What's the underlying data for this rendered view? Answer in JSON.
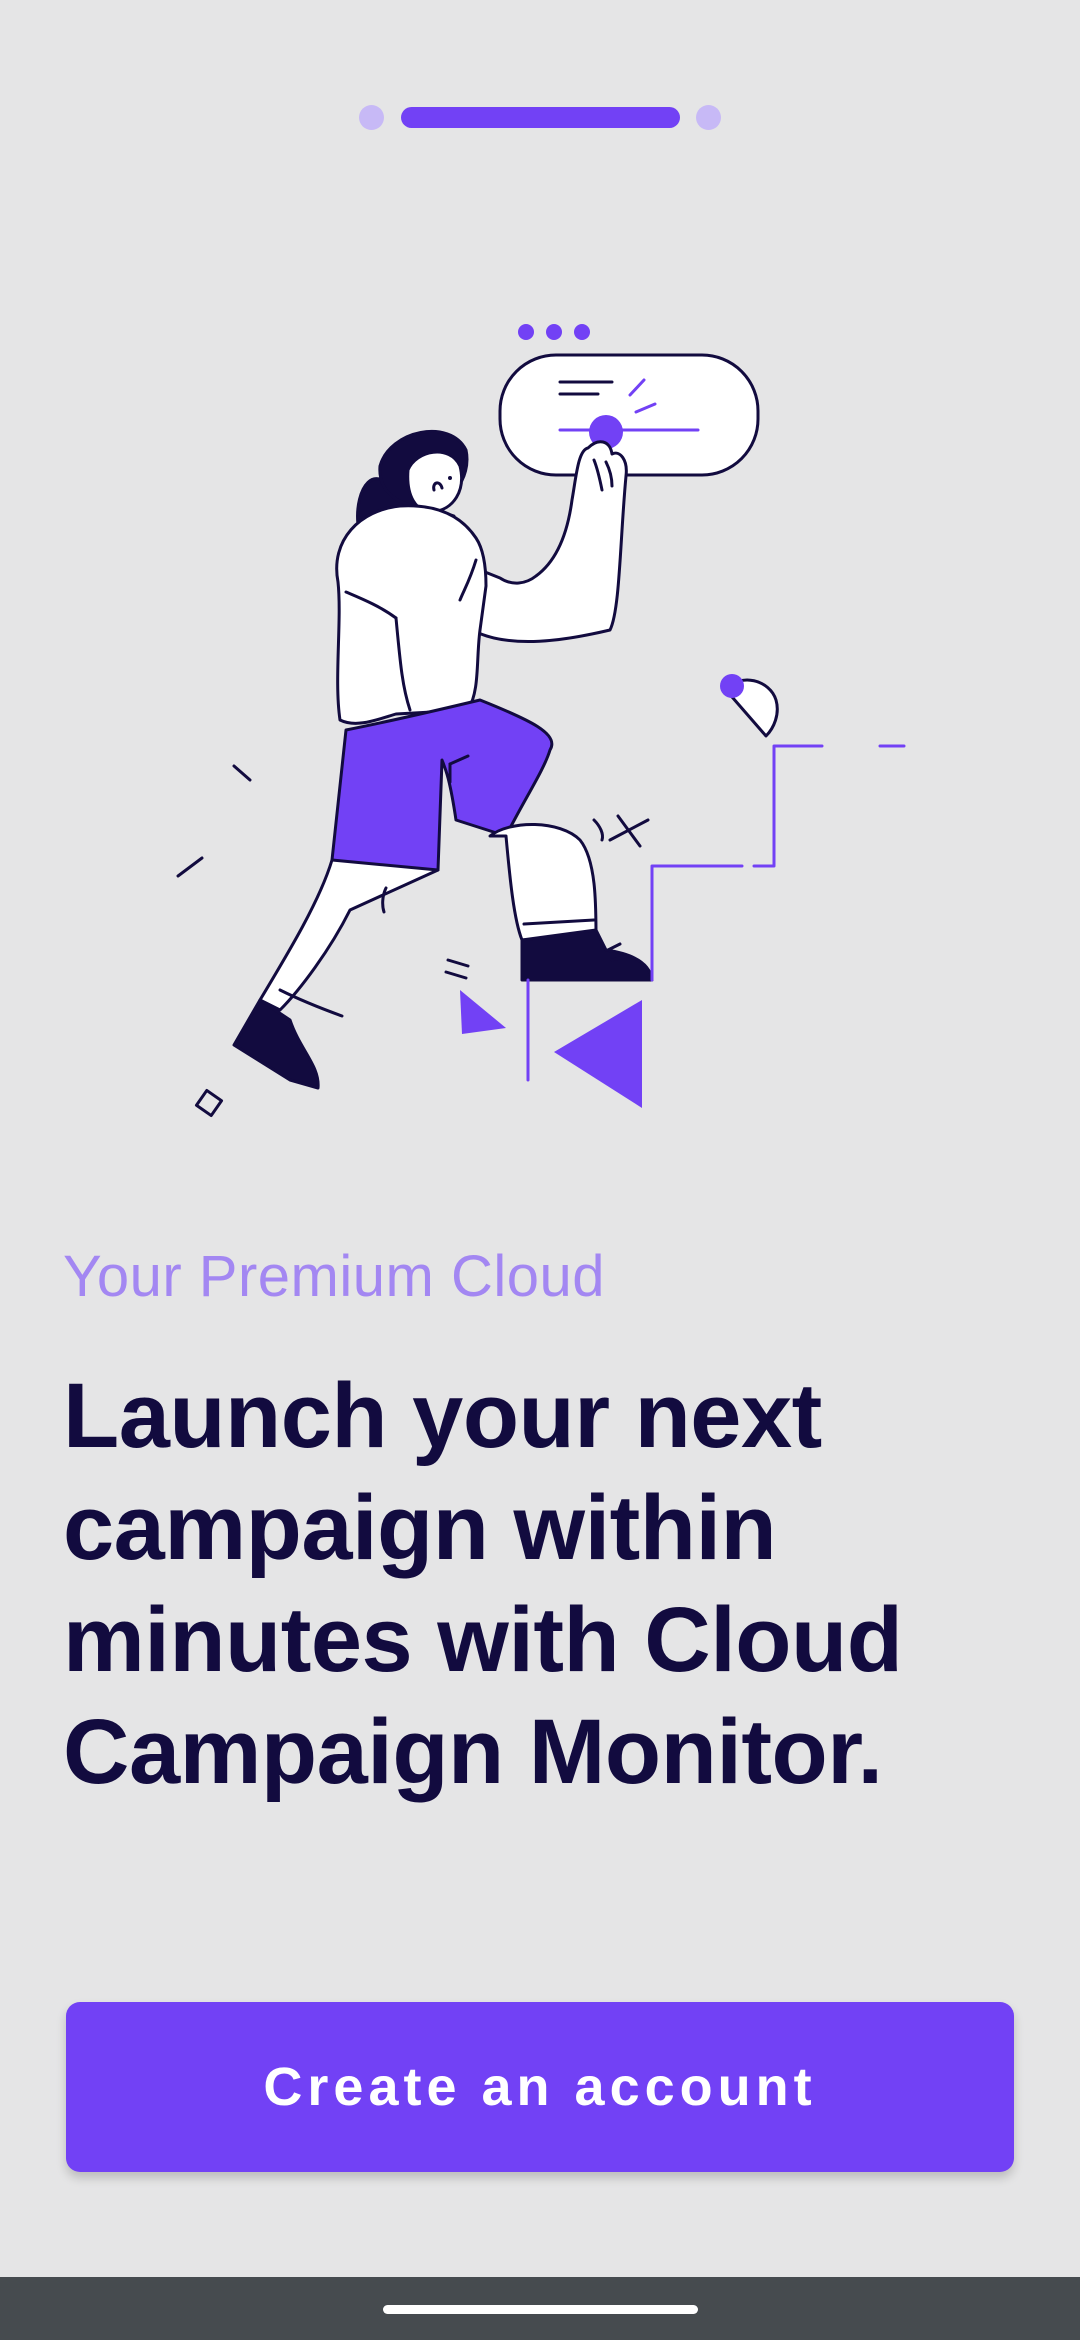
{
  "onboarding": {
    "pages_total": 3,
    "active_page": 2
  },
  "illustration": {
    "icon": "woman-stepping-up-stairs-tapping-slider-illustration"
  },
  "content": {
    "eyebrow": "Your Premium Cloud",
    "headline": "Launch your next campaign within minutes with Cloud Campaign Monitor."
  },
  "cta": {
    "label": "Create an account"
  },
  "colors": {
    "background": "#e5e5e6",
    "accent": "#7241f5",
    "accent_light": "#c7b9f6",
    "eyebrow": "#a387f2",
    "headline": "#120b3f",
    "nav_bar": "#464b4f"
  }
}
